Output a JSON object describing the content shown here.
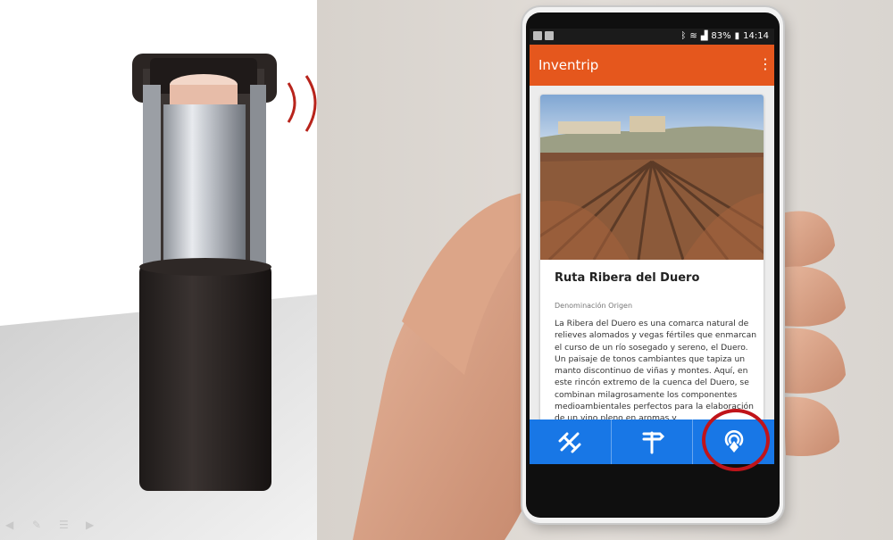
{
  "status_bar": {
    "battery": "83%",
    "time": "14:14"
  },
  "app": {
    "title": "Inventrip",
    "overflow_icon": "more-vert-icon",
    "accent": "#e5571d",
    "nav_color": "#1877e6"
  },
  "card": {
    "title": "Ruta Ribera del Duero",
    "subtitle": "Denominación Origen",
    "body": "La Ribera del Duero es una comarca natural de relieves alomados y vegas fértiles que enmarcan el curso de un río sosegado y sereno, el Duero. Un paisaje de tonos cambiantes que tapiza un manto discontinuo de viñas y montes. Aquí, en este rincón extremo de la cuenca del Duero, se combinan milagrosamente los componentes medioambientales perfectos para la elaboración de un vino pleno en aromas y"
  },
  "bottom_nav": {
    "items": [
      {
        "icon": "satellite-icon"
      },
      {
        "icon": "signpost-icon"
      },
      {
        "icon": "beacon-location-icon"
      }
    ]
  },
  "highlight_color": "#c0141a"
}
